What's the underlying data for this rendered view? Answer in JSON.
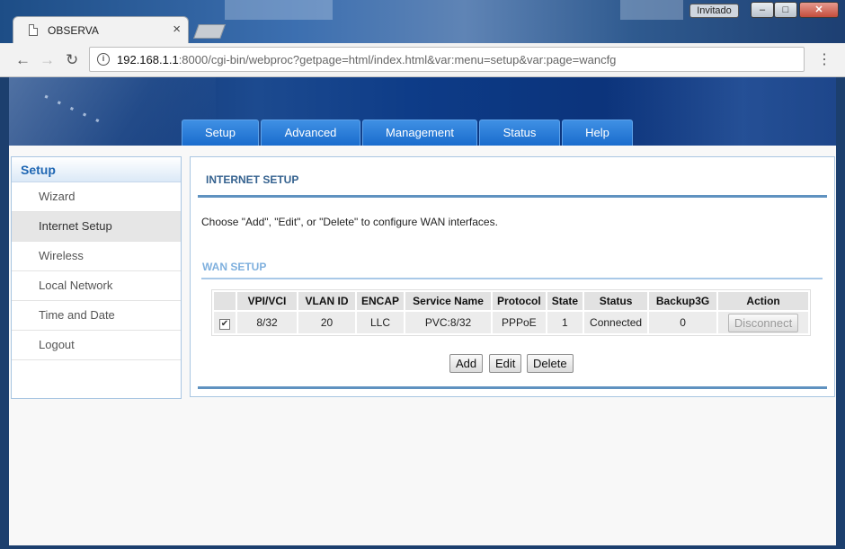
{
  "browser": {
    "tab_title": "OBSERVA",
    "guest_label": "Invitado",
    "url_host": "192.168.1.1",
    "url_rest": ":8000/cgi-bin/webproc?getpage=html/index.html&var:menu=setup&var:page=wancfg"
  },
  "nav": {
    "tabs": [
      {
        "label": "Setup"
      },
      {
        "label": "Advanced"
      },
      {
        "label": "Management"
      },
      {
        "label": "Status"
      },
      {
        "label": "Help"
      }
    ]
  },
  "sidebar": {
    "title": "Setup",
    "items": [
      {
        "label": "Wizard"
      },
      {
        "label": "Internet Setup",
        "active": true
      },
      {
        "label": "Wireless"
      },
      {
        "label": "Local Network"
      },
      {
        "label": "Time and Date"
      },
      {
        "label": "Logout"
      }
    ]
  },
  "main": {
    "title": "INTERNET SETUP",
    "description": "Choose \"Add\", \"Edit\", or \"Delete\" to configure WAN interfaces.",
    "section_title": "WAN SETUP",
    "table": {
      "headers": [
        "VPI/VCI",
        "VLAN ID",
        "ENCAP",
        "Service Name",
        "Protocol",
        "State",
        "Status",
        "Backup3G",
        "Action"
      ],
      "rows": [
        {
          "checked": true,
          "vpi_vci": "8/32",
          "vlan_id": "20",
          "encap": "LLC",
          "service_name": "PVC:8/32",
          "protocol": "PPPoE",
          "state": "1",
          "status": "Connected",
          "backup3g": "0",
          "action": "Disconnect"
        }
      ]
    },
    "buttons": {
      "add": "Add",
      "edit": "Edit",
      "delete": "Delete"
    }
  }
}
